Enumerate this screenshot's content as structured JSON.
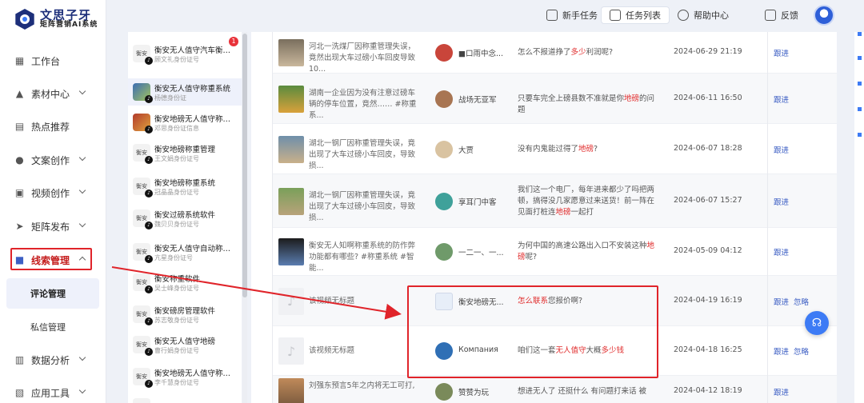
{
  "brand": {
    "title": "文思子牙",
    "subtitle": "矩阵营销AI系统"
  },
  "nav": {
    "items": [
      {
        "label": "工作台",
        "icon": "grid-icon"
      },
      {
        "label": "素材中心",
        "icon": "mountain-icon"
      },
      {
        "label": "热点推荐",
        "icon": "book-icon"
      },
      {
        "label": "文案创作",
        "icon": "bulb-icon"
      },
      {
        "label": "视频创作",
        "icon": "video-icon"
      },
      {
        "label": "矩阵发布",
        "icon": "send-icon"
      },
      {
        "label": "线索管理",
        "icon": "inbox-icon"
      },
      {
        "label": "数据分析",
        "icon": "bar-chart-icon"
      },
      {
        "label": "应用工具",
        "icon": "toolbox-icon"
      }
    ],
    "sub_items": [
      "评论管理",
      "私信管理"
    ]
  },
  "topbar": {
    "novice": "新手任务",
    "tasks": "任务列表",
    "help": "帮助中心",
    "feedback": "反馈"
  },
  "contacts": [
    {
      "name": "衡安无人值守汽车衡系统",
      "sub": "顾文礼身份证号",
      "badge": "1"
    },
    {
      "name": "衡安无人值守称重系统",
      "sub": "杨德身份证"
    },
    {
      "name": "衡安地磅无人值守称重...",
      "sub": "邓思身份证信息"
    },
    {
      "name": "衡安地磅称重管理",
      "sub": "王文娟身份证号"
    },
    {
      "name": "衡安地磅称重系统",
      "sub": "冠晶晶身份证号"
    },
    {
      "name": "衡安过磅系统软件",
      "sub": "魏贝贝身份证号"
    },
    {
      "name": "衡安无人值守自动称重...",
      "sub": "亢星身份证号"
    },
    {
      "name": "衡安称重软件",
      "sub": "吴士峰身份证号"
    },
    {
      "name": "衡安磅房管理软件",
      "sub": "苏志敬身份证号"
    },
    {
      "name": "衡安无人值守地磅",
      "sub": "曹行娟身份证号"
    },
    {
      "name": "衡安地磅无人值守称重...",
      "sub": "李千慧身份证号"
    },
    {
      "name": "衡安无人值守智能地磅",
      "sub": ""
    }
  ],
  "rows": [
    {
      "title": "河北一洗煤厂因称重管理失误，竟然出现大车过磅小车回皮导致10...",
      "user": "■口雨中念...",
      "comment": [
        [
          "怎么不报道挣了",
          ""
        ],
        [
          "多少",
          "hl"
        ],
        [
          "利润呢?",
          ""
        ]
      ],
      "time": "2024-06-29 21:19",
      "actions": [
        "跟进"
      ]
    },
    {
      "title": "湖南一企业因为没有注意过磅车辆的停车位置，竟然…… #称重系...",
      "user": "战场无亚军",
      "comment": [
        [
          "只要车完全上磅县数不准就是你",
          ""
        ],
        [
          "地磅",
          "hl"
        ],
        [
          "的问题",
          ""
        ]
      ],
      "time": "2024-06-11 16:50",
      "actions": [
        "跟进"
      ]
    },
    {
      "title": "湖北一钢厂因称重管理失误，竟出现了大车过磅小车回皮，导致损...",
      "user": "大贾",
      "comment": [
        [
          "没有内鬼能过得了",
          ""
        ],
        [
          "地磅",
          "hl"
        ],
        [
          "?",
          ""
        ]
      ],
      "time": "2024-06-07 18:28",
      "actions": [
        "跟进"
      ]
    },
    {
      "title": "湖北一钢厂因称重管理失误，竟出现了大车过磅小车回皮，导致损...",
      "user": "享耳门中客",
      "comment": [
        [
          "我们这一个电厂，每年进来都少了吗把两顿，搞得没几家愿意过来送货！前一阵在见面打桩连",
          ""
        ],
        [
          "地磅",
          "hl"
        ],
        [
          "一起打",
          ""
        ]
      ],
      "time": "2024-06-07 15:27",
      "actions": [
        "跟进"
      ]
    },
    {
      "title": "衡安无人知啊称重系统的防作弊功能都有哪些? #称重系统 #智能...",
      "user": "一二一、一...",
      "comment": [
        [
          "为何中国的高速公路出入口不安装这种",
          ""
        ],
        [
          "地磅",
          "hl"
        ],
        [
          "呢?",
          ""
        ]
      ],
      "time": "2024-05-09 04:12",
      "actions": [
        "跟进"
      ]
    },
    {
      "title": "该视频无标题",
      "user": "衡安地磅无...",
      "comment": [
        [
          "怎么联系",
          "hl"
        ],
        [
          "您报价啊?",
          ""
        ]
      ],
      "time": "2024-04-19 16:19",
      "actions": [
        "跟进",
        "忽略"
      ]
    },
    {
      "title": "该视频无标题",
      "user": "Компания",
      "comment": [
        [
          "咱们这一套",
          ""
        ],
        [
          "无人值守",
          "hl"
        ],
        [
          "大概",
          ""
        ],
        [
          "多少钱",
          "hl"
        ]
      ],
      "time": "2024-04-18 16:25",
      "actions": [
        "跟进",
        "忽略"
      ]
    },
    {
      "title": "刘强东预言5年之内将无工可打,",
      "user": "赞赞为玩",
      "comment": [
        [
          "想进无人了 还挺什么 有问题打来话 被",
          ""
        ]
      ],
      "time": "2024-04-12 18:19",
      "actions": [
        "跟进"
      ]
    }
  ]
}
